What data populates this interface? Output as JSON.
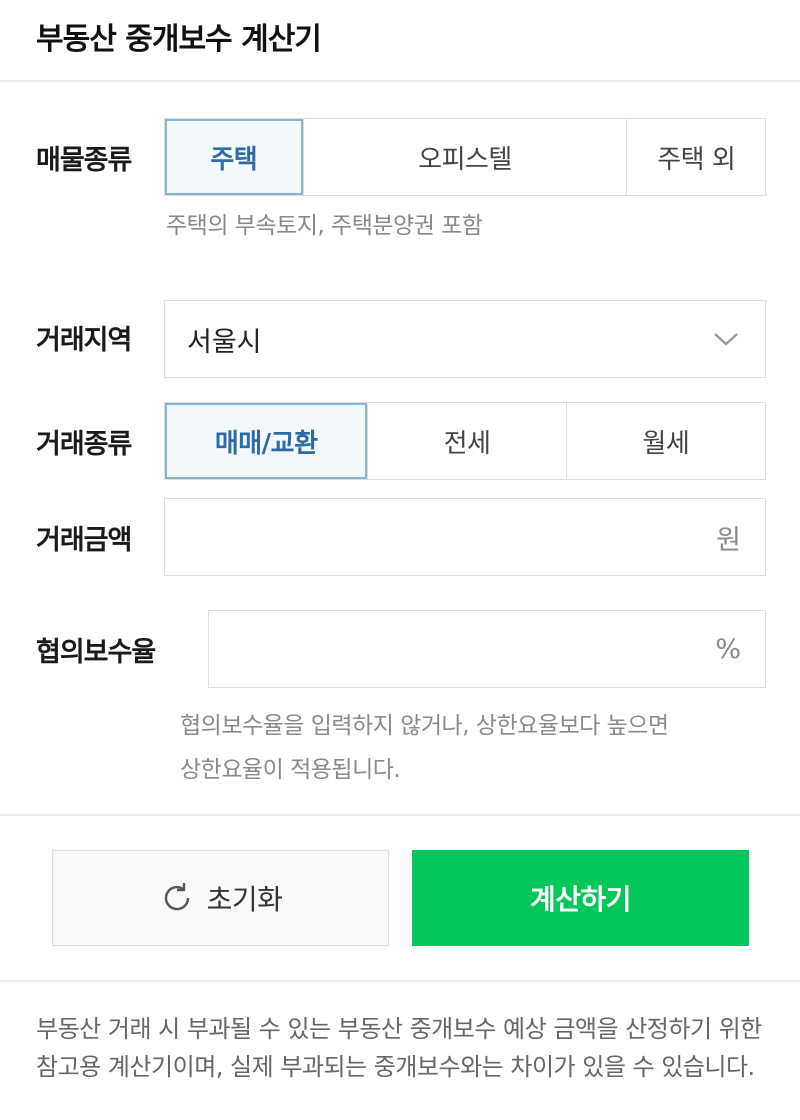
{
  "header": {
    "title": "부동산 중개보수 계산기"
  },
  "property_type": {
    "label": "매물종류",
    "options": [
      "주택",
      "오피스텔",
      "주택 외"
    ],
    "selected": "주택",
    "hint": "주택의 부속토지, 주택분양권 포함"
  },
  "region": {
    "label": "거래지역",
    "value": "서울시",
    "icon": "chevron-down-icon"
  },
  "deal_type": {
    "label": "거래종류",
    "options": [
      "매매/교환",
      "전세",
      "월세"
    ],
    "selected": "매매/교환"
  },
  "amount": {
    "label": "거래금액",
    "value": "",
    "unit": "원"
  },
  "rate": {
    "label": "협의보수율",
    "value": "",
    "unit": "%",
    "hint_line1": "협의보수율을 입력하지 않거나, 상한요율보다 높으면",
    "hint_line2": "상한요율이 적용됩니다."
  },
  "buttons": {
    "reset_label": "초기화",
    "reset_icon": "refresh-icon",
    "calc_label": "계산하기"
  },
  "footnote": "부동산 거래 시 부과될 수 있는 부동산 중개보수 예상 금액을 산정하기 위한 참고용 계산기이며, 실제 부과되는 중개보수와는 차이가 있을 수 있습니다.",
  "colors": {
    "accent": "#2f6aa8",
    "primary_button": "#03c75a",
    "active_bg": "#f3f8fc"
  }
}
